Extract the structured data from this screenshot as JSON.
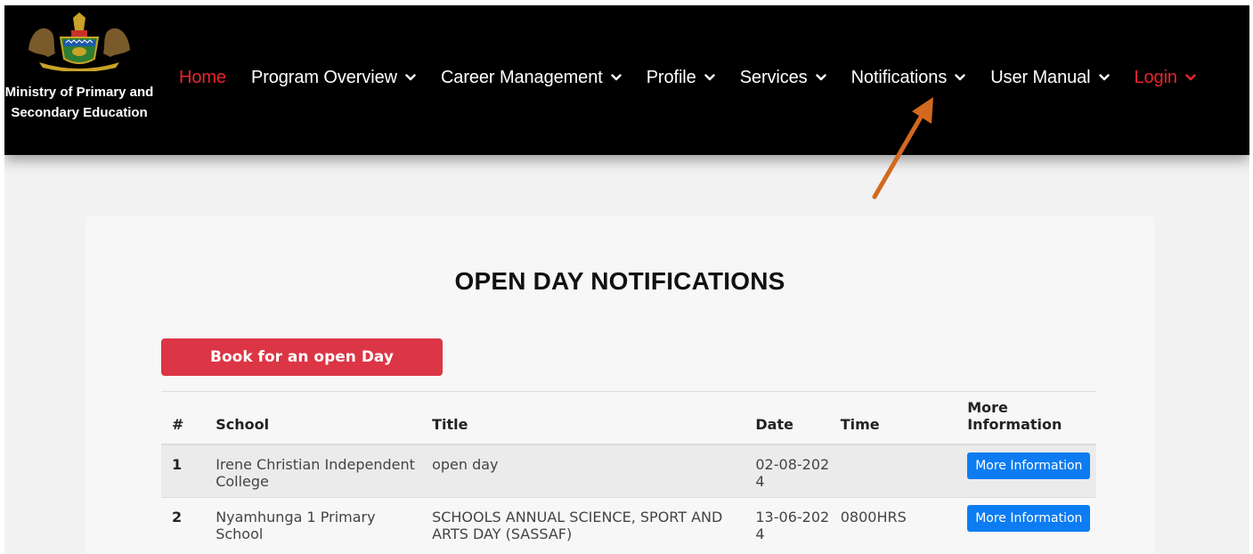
{
  "brand": {
    "name": "Ministry of Primary and Secondary Education",
    "logo_icon": "coat-of-arms-icon"
  },
  "nav": {
    "items": [
      {
        "label": "Home",
        "color": "#e8242c",
        "has_dropdown": false
      },
      {
        "label": "Program Overview",
        "color": "#ffffff",
        "has_dropdown": true
      },
      {
        "label": "Career Management",
        "color": "#ffffff",
        "has_dropdown": true
      },
      {
        "label": "Profile",
        "color": "#ffffff",
        "has_dropdown": true
      },
      {
        "label": "Services",
        "color": "#ffffff",
        "has_dropdown": true
      },
      {
        "label": "Notifications",
        "color": "#ffffff",
        "has_dropdown": true
      },
      {
        "label": "User Manual",
        "color": "#ffffff",
        "has_dropdown": true
      },
      {
        "label": "Login",
        "color": "#e8242c",
        "has_dropdown": true
      }
    ],
    "annotation_arrow_color": "#d2691e"
  },
  "page": {
    "title": "OPEN DAY NOTIFICATIONS",
    "book_button_label": "Book for an open Day",
    "book_button_color": "#dc3545"
  },
  "table": {
    "headers": {
      "num": "#",
      "school": "School",
      "title": "Title",
      "date": "Date",
      "time": "Time",
      "more": "More Information"
    },
    "rows": [
      {
        "num": "1",
        "school": "Irene Christian Independent College",
        "title": "open day",
        "date": "02-08-2024",
        "time": "",
        "button": "More Information"
      },
      {
        "num": "2",
        "school": "Nyamhunga 1 Primary School",
        "title": "SCHOOLS ANNUAL SCIENCE, SPORT AND ARTS DAY (SASSAF)",
        "date": "13-06-2024",
        "time": "0800HRS",
        "button": "More Information"
      }
    ],
    "button_color": "#0d7cf2"
  }
}
